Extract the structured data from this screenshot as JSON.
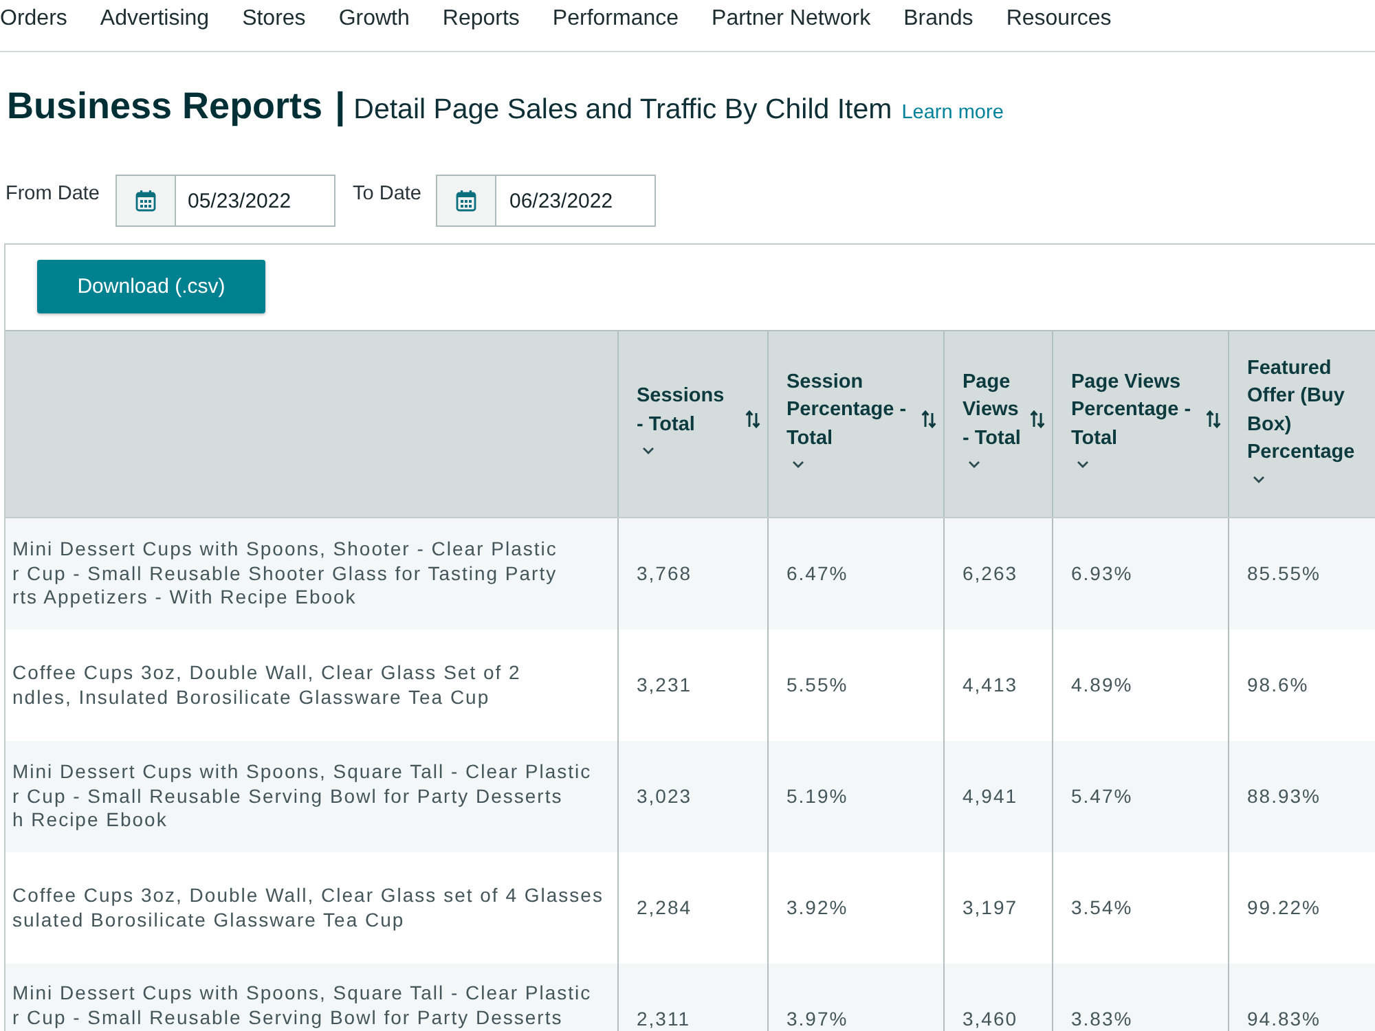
{
  "nav": [
    "Orders",
    "Advertising",
    "Stores",
    "Growth",
    "Reports",
    "Performance",
    "Partner Network",
    "Brands",
    "Resources"
  ],
  "header": {
    "title": "Business Reports",
    "separator": "|",
    "subtitle": "Detail Page Sales and Traffic By Child Item",
    "link": "Learn more"
  },
  "date_filters": [
    {
      "label": "From Date",
      "value": "05/23/2022"
    },
    {
      "label": "To Date",
      "value": "06/23/2022"
    }
  ],
  "download_button": "Download (.csv)",
  "table": {
    "columns": [
      {
        "label": "Sessions - Total",
        "sortable": true
      },
      {
        "label": "Session Percentage - Total",
        "sortable": true
      },
      {
        "label": "Page Views - Total",
        "sortable": true
      },
      {
        "label": "Page Views Percentage - Total",
        "sortable": true
      },
      {
        "label": "Featured Offer (Buy Box) Percentage",
        "sortable": false
      }
    ],
    "rows": [
      {
        "product": "Mini Dessert Cups with Spoons, Shooter - Clear Plastic\nr Cup - Small Reusable Shooter Glass for Tasting Party\nrts Appetizers - With Recipe Ebook",
        "cells": [
          "3,768",
          "6.47%",
          "6,263",
          "6.93%",
          "85.55%"
        ]
      },
      {
        "product": "Coffee Cups 3oz, Double Wall, Clear Glass Set of 2\nndles, Insulated Borosilicate Glassware Tea Cup",
        "cells": [
          "3,231",
          "5.55%",
          "4,413",
          "4.89%",
          "98.6%"
        ]
      },
      {
        "product": "Mini Dessert Cups with Spoons, Square Tall - Clear Plastic\nr Cup - Small Reusable Serving Bowl for Party Desserts\nh Recipe Ebook",
        "cells": [
          "3,023",
          "5.19%",
          "4,941",
          "5.47%",
          "88.93%"
        ]
      },
      {
        "product": "Coffee Cups 3oz, Double Wall, Clear Glass set of 4 Glasses\nsulated Borosilicate Glassware Tea Cup",
        "cells": [
          "2,284",
          "3.92%",
          "3,197",
          "3.54%",
          "99.22%"
        ]
      },
      {
        "product": "Mini Dessert Cups with Spoons, Square Tall - Clear Plastic\nr Cup - Small Reusable Serving Bowl for Party Desserts",
        "cells": [
          "2,311",
          "3.97%",
          "3,460",
          "3.83%",
          "94.83%"
        ]
      }
    ]
  }
}
